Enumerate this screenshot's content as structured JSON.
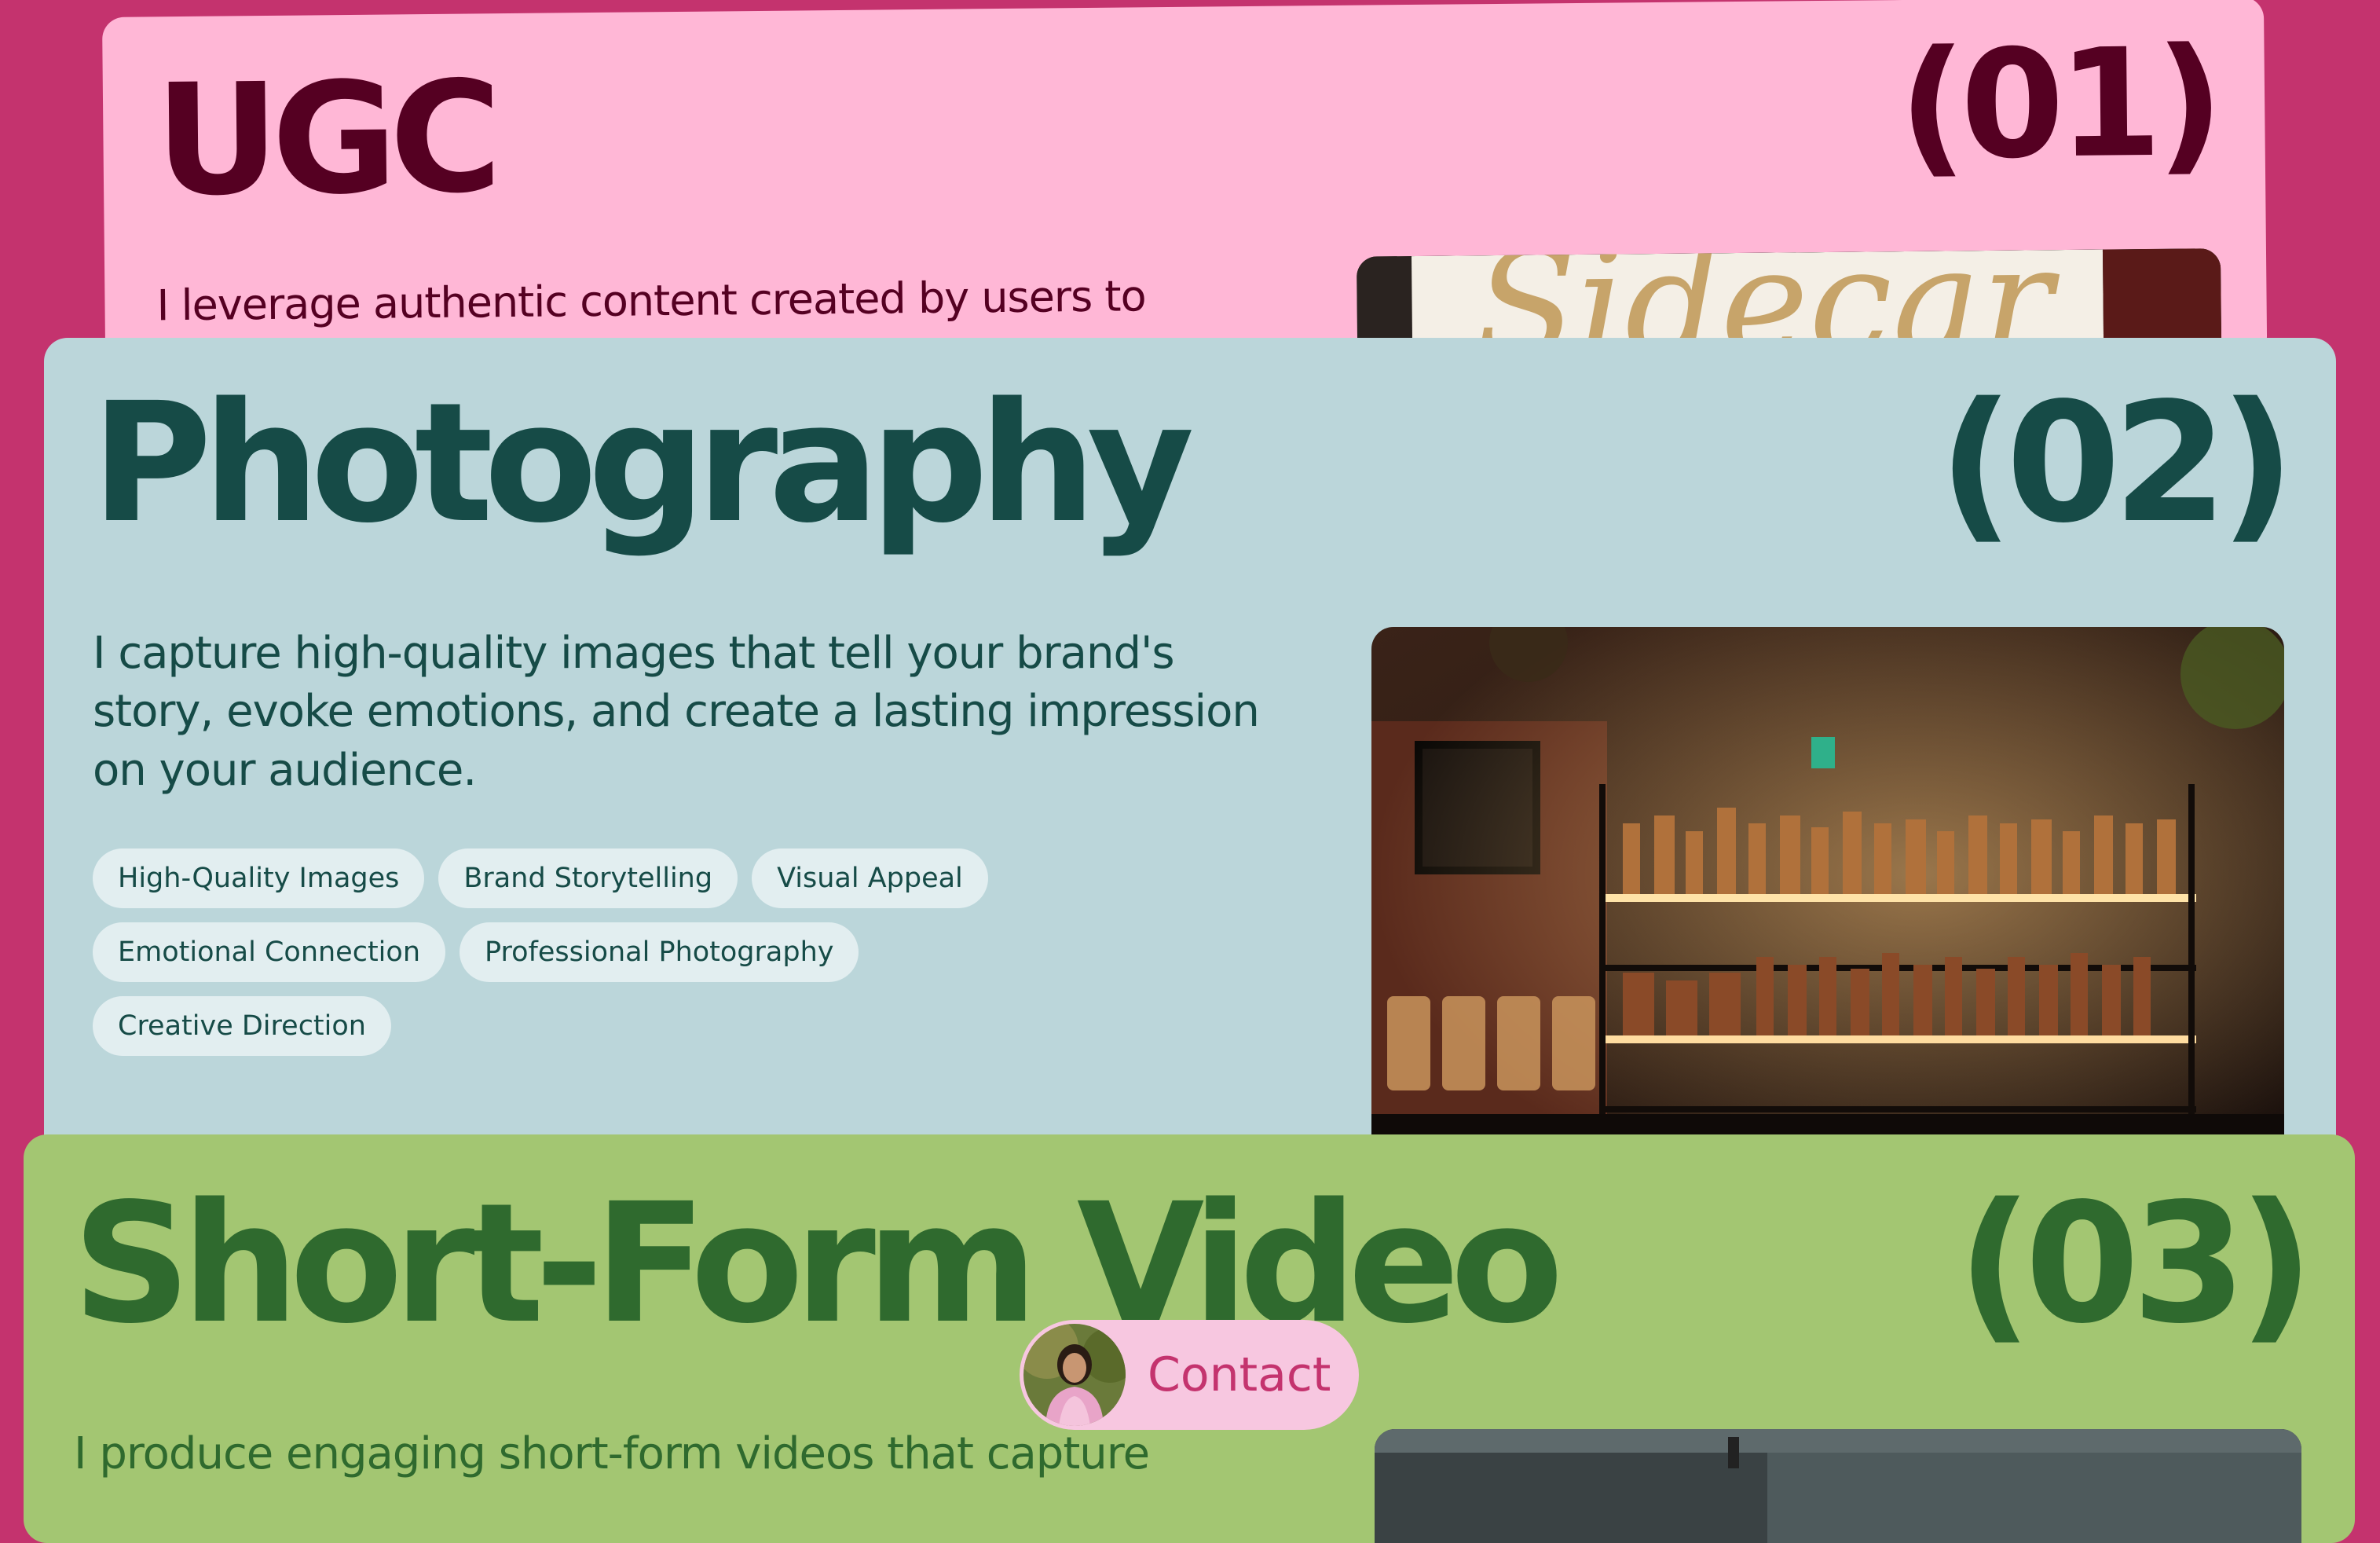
{
  "services": [
    {
      "title": "UGC",
      "number": "(01)",
      "description": "I leverage authentic content created by users to",
      "image_caption": "Sidecar"
    },
    {
      "title": "Photography",
      "number": "(02)",
      "description": "I capture high-quality images that tell your brand's story, evoke emotions, and create a lasting impression on your audience.",
      "tags": [
        "High-Quality Images",
        "Brand Storytelling",
        "Visual Appeal",
        "Emotional Connection",
        "Professional Photography",
        "Creative Direction"
      ]
    },
    {
      "title": "Short-Form Video",
      "number": "(03)",
      "description": "I produce engaging short-form videos that capture"
    }
  ],
  "contact": {
    "label": "Contact"
  },
  "colors": {
    "background": "#c4336e",
    "ugc_card": "#ffb7d6",
    "ugc_text": "#550022",
    "photo_card": "#bbd6da",
    "photo_text": "#164b47",
    "video_card": "#a3c672",
    "video_text": "#2f6a2e",
    "contact_bg": "#f7c7e0"
  }
}
